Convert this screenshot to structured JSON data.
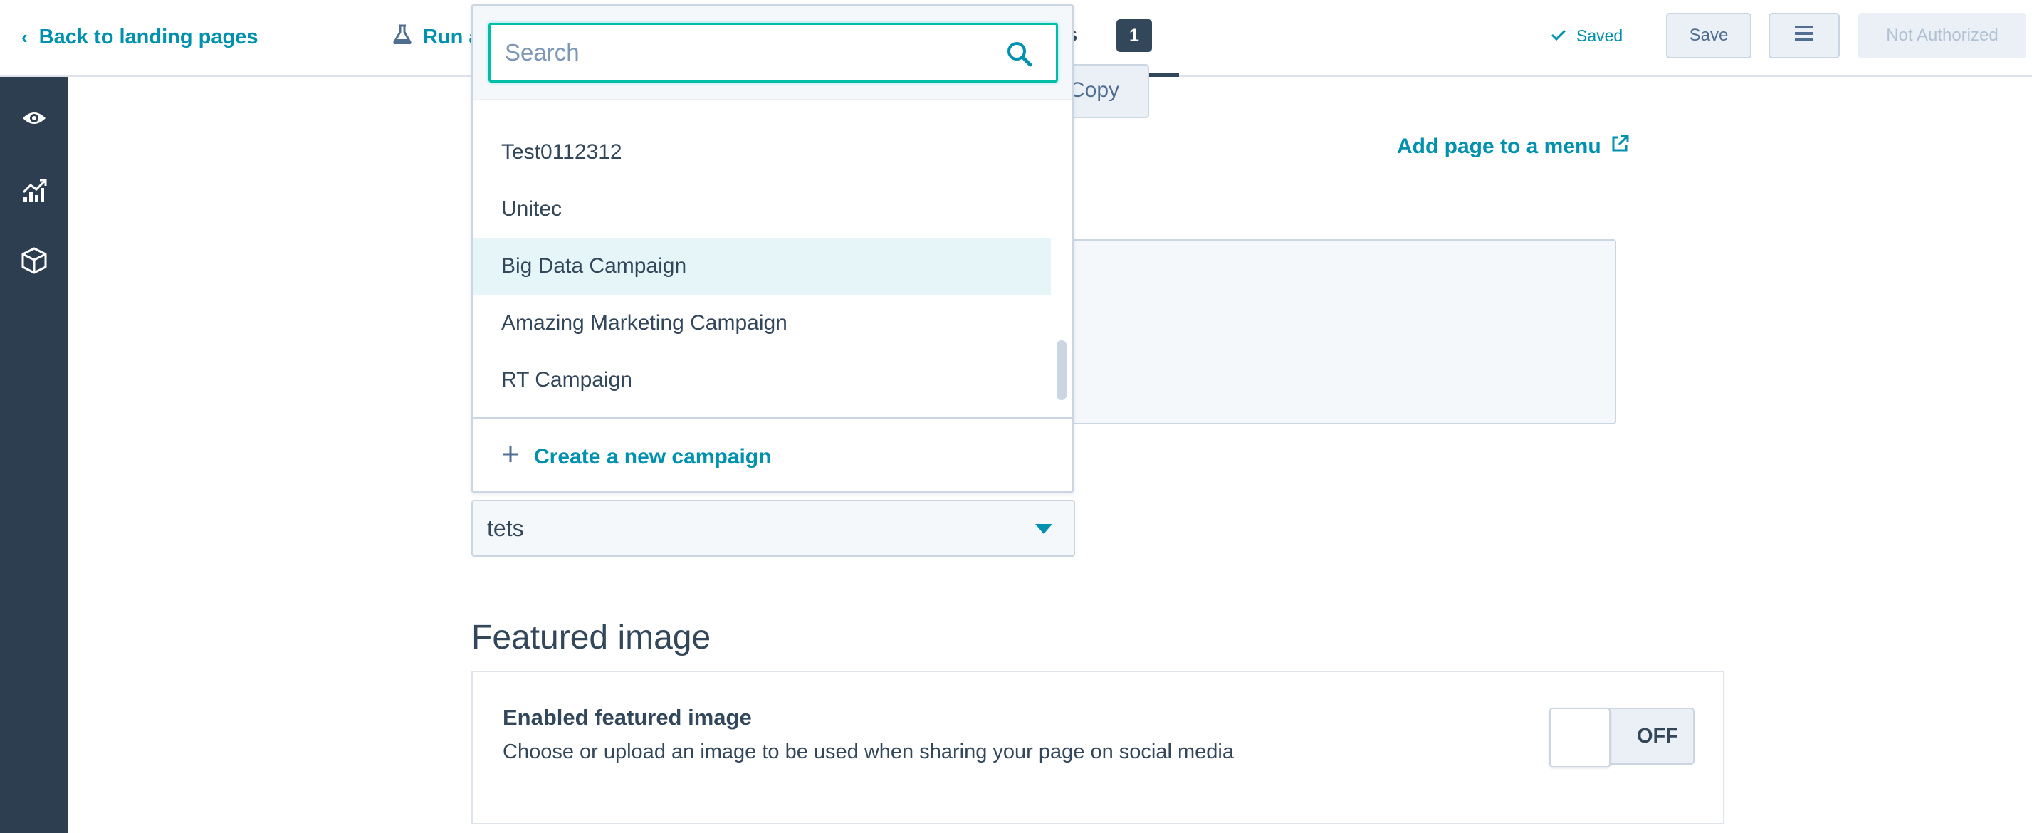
{
  "topbar": {
    "back_label": "Back to landing pages",
    "run_test_label": "Run a",
    "settings_tab_label": "ngs",
    "settings_tab_count": "1",
    "saved_label": "Saved",
    "save_button": "Save",
    "not_authorized_button": "Not Authorized"
  },
  "sidebar": {
    "icons": [
      "eye-icon",
      "chart-icon",
      "cube-icon"
    ]
  },
  "main": {
    "copy_label": "Copy",
    "add_to_menu_label": "Add page to a menu",
    "campaign_value": "tets",
    "featured_title": "Featured image",
    "featured_option_title": "Enabled featured image",
    "featured_option_desc": "Choose or upload an image to be used when sharing your page on social media",
    "featured_toggle_state": "OFF"
  },
  "dropdown": {
    "search_placeholder": "Search",
    "items": [
      {
        "label": "Test0112312",
        "active": false
      },
      {
        "label": "Unitec",
        "active": false
      },
      {
        "label": "Big Data Campaign",
        "active": true
      },
      {
        "label": "Amazing Marketing Campaign",
        "active": false
      },
      {
        "label": "RT Campaign",
        "active": false
      }
    ],
    "create_label": "Create a new campaign"
  },
  "colors": {
    "accent": "#0091ae",
    "sidebar_bg": "#2d3e50",
    "text": "#33475b",
    "highlight": "#e5f5f8"
  }
}
